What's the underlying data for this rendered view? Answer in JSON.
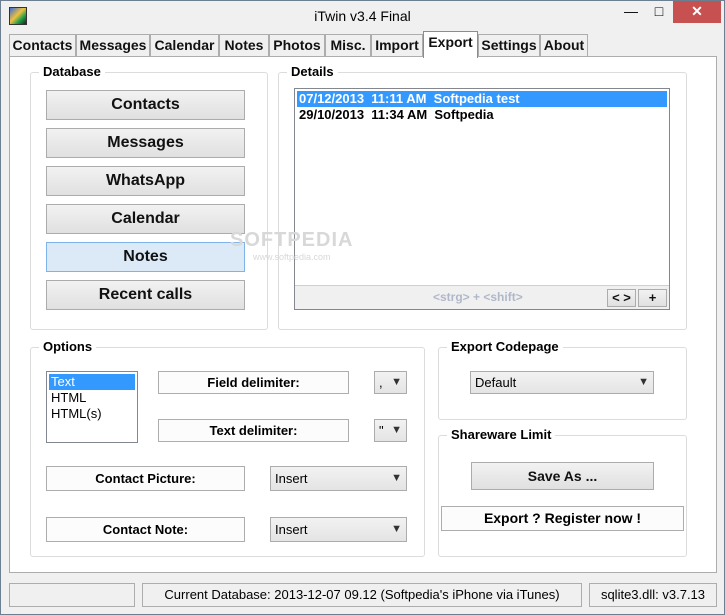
{
  "window": {
    "title": "iTwin v3.4 Final",
    "minimize": "—",
    "maximize": "□",
    "close": "✕"
  },
  "tabs": [
    "Contacts",
    "Messages",
    "Calendar",
    "Notes",
    "Photos",
    "Misc.",
    "Import",
    "Export",
    "Settings",
    "About"
  ],
  "active_tab": "Export",
  "database": {
    "label": "Database",
    "buttons": [
      "Contacts",
      "Messages",
      "WhatsApp",
      "Calendar",
      "Notes",
      "Recent calls"
    ],
    "selected": "Notes"
  },
  "details": {
    "label": "Details",
    "items": [
      "07/12/2013  11:11 AM  Softpedia test",
      "29/10/2013  11:34 AM  Softpedia"
    ],
    "hint": "<strg> + <shift>",
    "nav_button": "< >",
    "add_button": "+"
  },
  "options": {
    "label": "Options",
    "formats": [
      "Text",
      "HTML",
      "HTML(s)"
    ],
    "selected_format": "Text",
    "field_delimiter_label": "Field delimiter:",
    "field_delimiter_value": ",",
    "text_delimiter_label": "Text delimiter:",
    "text_delimiter_value": "\"",
    "contact_picture_label": "Contact Picture:",
    "contact_picture_value": "Insert",
    "contact_note_label": "Contact Note:",
    "contact_note_value": "Insert"
  },
  "codepage": {
    "label": "Export Codepage",
    "value": "Default"
  },
  "shareware": {
    "label": "Shareware Limit",
    "save_button": "Save As ...",
    "register_text": "Export ?   Register now !"
  },
  "watermark": {
    "text": "SOFTPEDIA",
    "sub": "www.softpedia.com"
  },
  "status": {
    "left": "",
    "database": "Current Database: 2013-12-07  09.12  (Softpedia's iPhone via iTunes)",
    "dll": "sqlite3.dll: v3.7.13"
  }
}
